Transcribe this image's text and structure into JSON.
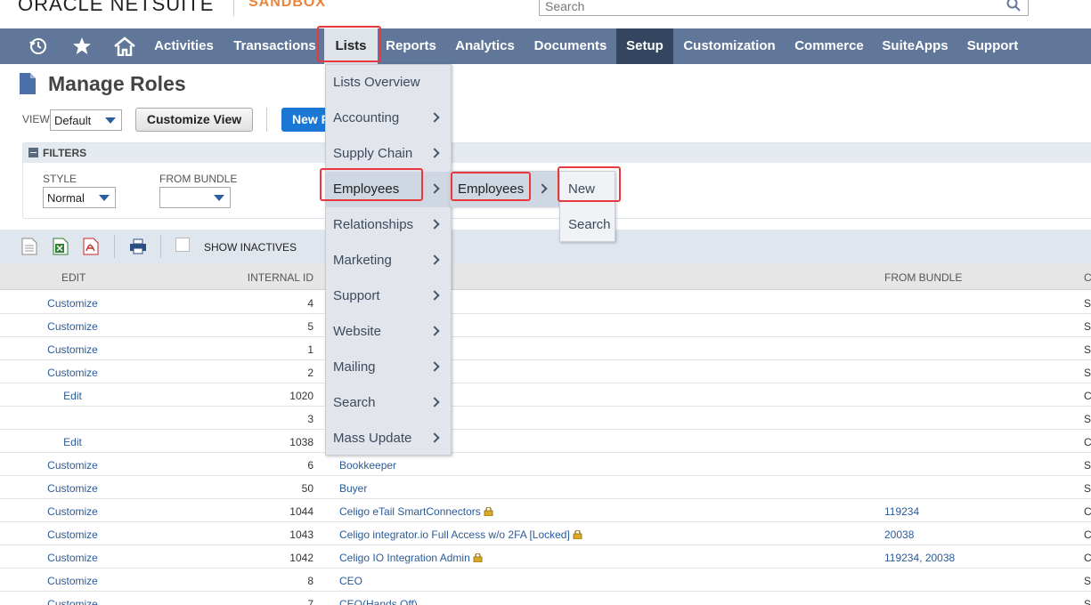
{
  "brand": {
    "logo_text": "ORACLE NETSUITE",
    "sandbox": "SANDBOX"
  },
  "search": {
    "placeholder": "Search"
  },
  "nav": {
    "items": [
      "Activities",
      "Transactions",
      "Lists",
      "Reports",
      "Analytics",
      "Documents",
      "Setup",
      "Customization",
      "Commerce",
      "SuiteApps",
      "Support"
    ]
  },
  "page": {
    "title": "Manage Roles"
  },
  "view": {
    "label": "VIEW",
    "value": "Default",
    "customize_label": "Customize View",
    "new_label": "New R"
  },
  "filters": {
    "title": "FILTERS",
    "style_label": "STYLE",
    "style_value": "Normal",
    "bundle_label": "FROM BUNDLE",
    "bundle_value": ""
  },
  "toolbar": {
    "show_inactives": "SHOW INACTIVES"
  },
  "table": {
    "headers": {
      "edit": "EDIT",
      "internal_id": "INTERNAL ID",
      "from_bundle": "FROM BUNDLE",
      "type": "C"
    },
    "rows": [
      {
        "edit": "Customize",
        "id": "4",
        "name": "",
        "bundle": "",
        "type": "St",
        "lock": false
      },
      {
        "edit": "Customize",
        "id": "5",
        "name": "",
        "bundle": "",
        "type": "St",
        "lock": false
      },
      {
        "edit": "Customize",
        "id": "1",
        "name": "",
        "bundle": "",
        "type": "St",
        "lock": false
      },
      {
        "edit": "Customize",
        "id": "2",
        "name": "",
        "bundle": "",
        "type": "St",
        "lock": false
      },
      {
        "edit": "Edit",
        "id": "1020",
        "name": "",
        "bundle": "",
        "type": "Cu",
        "lock": false
      },
      {
        "edit": "",
        "id": "3",
        "name": "",
        "bundle": "",
        "type": "St",
        "lock": false
      },
      {
        "edit": "Edit",
        "id": "1038",
        "name": "",
        "bundle": "",
        "type": "Cu",
        "lock": false
      },
      {
        "edit": "Customize",
        "id": "6",
        "name": "Bookkeeper",
        "bundle": "",
        "type": "St",
        "lock": false
      },
      {
        "edit": "Customize",
        "id": "50",
        "name": "Buyer",
        "bundle": "",
        "type": "St",
        "lock": false
      },
      {
        "edit": "Customize",
        "id": "1044",
        "name": "Celigo eTail SmartConnectors",
        "bundle": "119234",
        "type": "Cu",
        "lock": true
      },
      {
        "edit": "Customize",
        "id": "1043",
        "name": "Celigo integrator.io Full Access w/o 2FA [Locked]",
        "bundle": "20038",
        "type": "Cu",
        "lock": true
      },
      {
        "edit": "Customize",
        "id": "1042",
        "name": "Celigo IO Integration Admin",
        "bundle": "119234, 20038",
        "type": "Cu",
        "lock": true
      },
      {
        "edit": "Customize",
        "id": "8",
        "name": "CEO",
        "bundle": "",
        "type": "St",
        "lock": false
      },
      {
        "edit": "Customize",
        "id": "7",
        "name": "CEO(Hands Off)",
        "bundle": "",
        "type": "St",
        "lock": false
      }
    ]
  },
  "lists_menu": {
    "items": [
      "Lists Overview",
      "Accounting",
      "Supply Chain",
      "Employees",
      "Relationships",
      "Marketing",
      "Support",
      "Website",
      "Mailing",
      "Search",
      "Mass Update"
    ]
  },
  "employees_menu": {
    "items": [
      "Employees"
    ]
  },
  "employees_sub_menu": {
    "items": [
      "New",
      "Search"
    ]
  },
  "colors": {
    "nav_bg": "#607799",
    "setup_bg": "#34465f",
    "highlight": "#e8383d",
    "link": "#2a5b9a",
    "sandbox": "#e8843b",
    "new_button": "#1b77d4"
  }
}
